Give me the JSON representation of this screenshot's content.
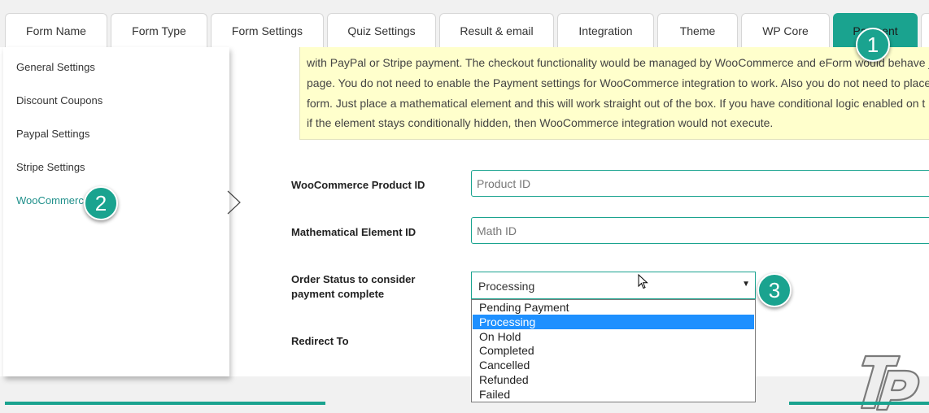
{
  "tabs": [
    {
      "label": "Form Name"
    },
    {
      "label": "Form Type"
    },
    {
      "label": "Form Settings"
    },
    {
      "label": "Quiz Settings"
    },
    {
      "label": "Result & email"
    },
    {
      "label": "Integration"
    },
    {
      "label": "Theme"
    },
    {
      "label": "WP Core"
    },
    {
      "label": "Payment"
    }
  ],
  "notice": {
    "lines": [
      "with PayPal or Stripe payment. The checkout functionality would be managed by WooCommerce and eForm would behave ju",
      "page. You do not need to enable the Payment settings for WooCommerce integration to work. Also you do not need to place",
      "form. Just place a mathematical element and this will work straight out of the box. If you have conditional logic enabled on t",
      "if the element stays conditionally hidden, then WooCommerce integration would not execute."
    ]
  },
  "sidebar": {
    "items": [
      {
        "label": "General Settings"
      },
      {
        "label": "Discount Coupons"
      },
      {
        "label": "Paypal Settings"
      },
      {
        "label": "Stripe Settings"
      },
      {
        "label": "WooCommerce"
      }
    ]
  },
  "form": {
    "product_id": {
      "label": "WooCommerce Product ID",
      "placeholder": "Product ID",
      "value": ""
    },
    "math_id": {
      "label": "Mathematical Element ID",
      "placeholder": "Math ID",
      "value": ""
    },
    "order_status": {
      "label_line1": "Order Status to consider",
      "label_line2": "payment complete",
      "selected": "Processing",
      "options": [
        "Pending Payment",
        "Processing",
        "On Hold",
        "Completed",
        "Cancelled",
        "Refunded",
        "Failed"
      ]
    },
    "redirect": {
      "label": "Redirect To"
    }
  },
  "badges": [
    "1",
    "2",
    "3"
  ],
  "colors": {
    "accent": "#1aa38f",
    "notice_bg": "#ffffcc",
    "selected_option": "#1e90ff"
  }
}
